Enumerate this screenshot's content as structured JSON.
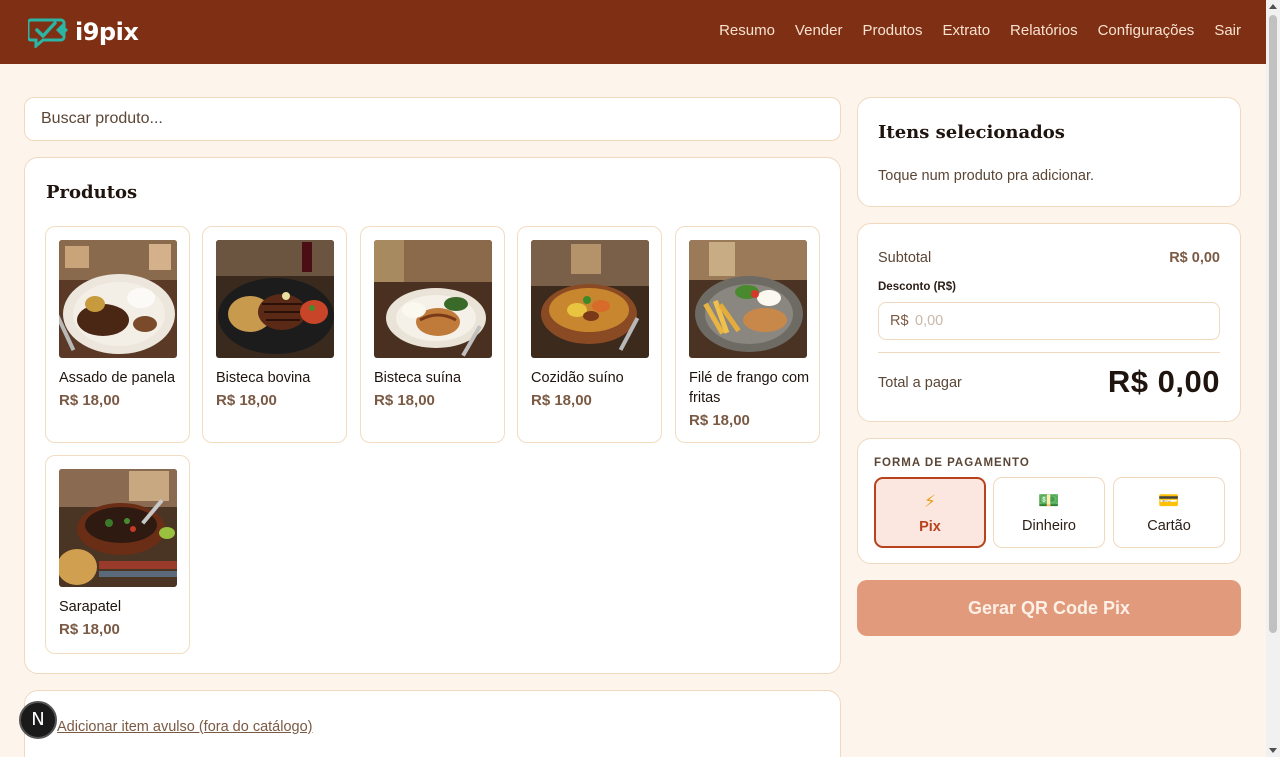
{
  "app": {
    "brand": "i9pix",
    "colors": {
      "header": "#7f2f13",
      "accent": "#b8421c",
      "background": "#fdf4ec",
      "cta": "#e19b7c",
      "logo_teal": "#2ab5a5"
    }
  },
  "nav": {
    "items": [
      {
        "label": "Resumo"
      },
      {
        "label": "Vender"
      },
      {
        "label": "Produtos"
      },
      {
        "label": "Extrato"
      },
      {
        "label": "Relatórios"
      },
      {
        "label": "Configurações"
      },
      {
        "label": "Sair"
      }
    ]
  },
  "search": {
    "placeholder": "Buscar produto..."
  },
  "products": {
    "title": "Produtos",
    "items": [
      {
        "name": "Assado de panela",
        "price": "R$ 18,00",
        "icon": "dish-photo"
      },
      {
        "name": "Bisteca bovina",
        "price": "R$ 18,00",
        "icon": "dish-photo"
      },
      {
        "name": "Bisteca suína",
        "price": "R$ 18,00",
        "icon": "dish-photo"
      },
      {
        "name": "Cozidão suíno",
        "price": "R$ 18,00",
        "icon": "dish-photo"
      },
      {
        "name": "Filé de frango com fritas",
        "price": "R$ 18,00",
        "icon": "dish-photo"
      },
      {
        "name": "Sarapatel",
        "price": "R$ 18,00",
        "icon": "dish-photo"
      }
    ]
  },
  "avulso": {
    "link_label": "Adicionar item avulso (fora do catálogo)"
  },
  "cart": {
    "title": "Itens selecionados",
    "empty_hint": "Toque num produto pra adicionar."
  },
  "totals": {
    "subtotal_label": "Subtotal",
    "subtotal_value": "R$ 0,00",
    "discount_label": "Desconto (R$)",
    "discount_prefix": "R$",
    "discount_placeholder": "0,00",
    "total_label": "Total a pagar",
    "total_value": "R$ 0,00"
  },
  "payment": {
    "label": "FORMA DE PAGAMENTO",
    "options": [
      {
        "label": "Pix",
        "icon": "lightning-icon",
        "glyph": "⚡",
        "selected": true
      },
      {
        "label": "Dinheiro",
        "icon": "cash-icon",
        "glyph": "💵",
        "selected": false
      },
      {
        "label": "Cartão",
        "icon": "credit-card-icon",
        "glyph": "💳",
        "selected": false
      }
    ]
  },
  "cta": {
    "label": "Gerar QR Code Pix"
  },
  "dev_badge": {
    "label": "N"
  }
}
